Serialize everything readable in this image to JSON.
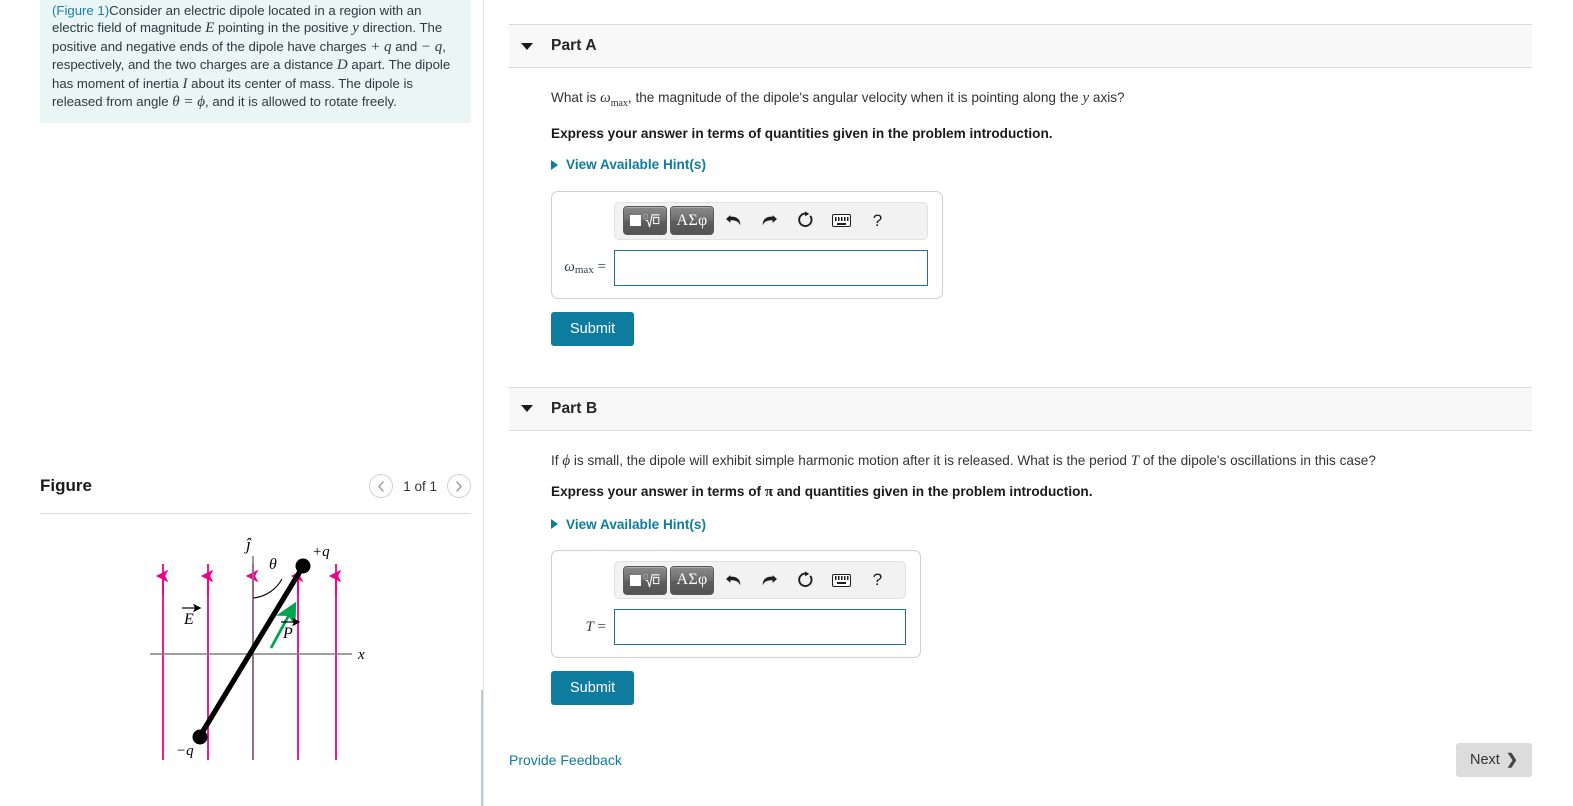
{
  "intro": {
    "figure_link": "(Figure 1)",
    "text_segments": [
      "Consider an electric dipole located in a region with an electric field of magnitude ",
      "E",
      " pointing in the positive ",
      "y",
      " direction. The positive and negative ends of the dipole have charges ",
      "+ q",
      " and ",
      "− q",
      ", respectively, and the two charges are a distance ",
      "D",
      " apart. The dipole has moment of inertia ",
      "I",
      " about its center of mass. The dipole is released from angle ",
      "θ = ϕ",
      ", and it is allowed to rotate freely."
    ]
  },
  "figure": {
    "title": "Figure",
    "counter": "1 of 1",
    "prev_icon": "chevron-left-icon",
    "next_icon": "chevron-right-icon",
    "labels": {
      "y_axis": "ĵ",
      "x_axis": "x",
      "field": "E",
      "dipole_moment": "P",
      "angle": "θ",
      "positive_charge": "+q",
      "negative_charge": "−q"
    },
    "colors": {
      "field_lines": "#ec008c",
      "dipole": "#000000",
      "moment_vector": "#00a550",
      "axes": "#808080"
    }
  },
  "parts": [
    {
      "label": "Part A",
      "caret_icon": "caret-down-icon",
      "question_pre": "What is ",
      "question_var": "ω",
      "question_sub": "max",
      "question_post": ", the magnitude of the dipole's angular velocity when it is pointing along the ",
      "question_italic": "y",
      "question_end": " axis?",
      "instruction": "Express your answer in terms of quantities given in the problem introduction.",
      "hints_label": "View Available Hint(s)",
      "toolbar": {
        "template_btn": "math-template-button",
        "greek_btn": "ΑΣφ",
        "undo_icon": "undo-icon",
        "redo_icon": "redo-icon",
        "reset_icon": "reset-icon",
        "keyboard_icon": "keyboard-icon",
        "help_label": "?"
      },
      "answer_var": "ω",
      "answer_sub": "max",
      "answer_eq": " = ",
      "answer_value": "",
      "submit_label": "Submit"
    },
    {
      "label": "Part B",
      "caret_icon": "caret-down-icon",
      "question_pre": "If ",
      "question_var": "ϕ",
      "question_sub": "",
      "question_post": " is small, the dipole will exhibit simple harmonic motion after it is released. What is the period ",
      "question_italic": "T",
      "question_end": " of the dipole's oscillations in this case?",
      "instruction_pre": "Express your answer in terms of ",
      "instruction_pi": "π",
      "instruction_post": " and quantities given in the problem introduction.",
      "instruction": "Express your answer in terms of π and quantities given in the problem introduction.",
      "hints_label": "View Available Hint(s)",
      "toolbar": {
        "template_btn": "math-template-button",
        "greek_btn": "ΑΣφ",
        "undo_icon": "undo-icon",
        "redo_icon": "redo-icon",
        "reset_icon": "reset-icon",
        "keyboard_icon": "keyboard-icon",
        "help_label": "?"
      },
      "answer_var": "T",
      "answer_sub": "",
      "answer_eq": " = ",
      "answer_value": "",
      "submit_label": "Submit"
    }
  ],
  "footer": {
    "feedback_label": "Provide Feedback",
    "next_label": "Next",
    "next_icon": "chevron-right-icon"
  },
  "theme": {
    "accent": "#0e7c9e",
    "intro_bg": "#e9f6f5",
    "header_bg": "#f8f8f8",
    "next_bg": "#dcdcdc"
  }
}
